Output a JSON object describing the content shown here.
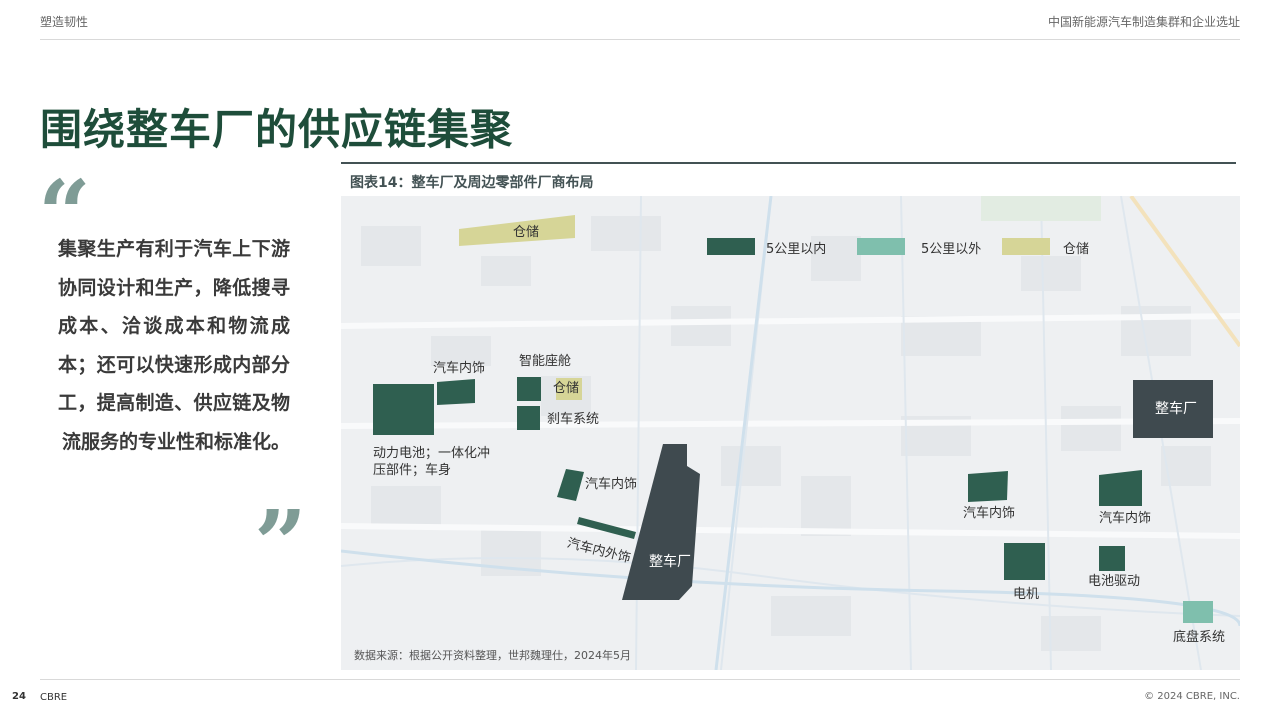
{
  "header": {
    "section": "塑造韧性",
    "report": "中国新能源汽车制造集群和企业选址"
  },
  "page_title": "围绕整车厂的供应链集聚",
  "quote": {
    "open_mark": "“",
    "close_mark": "”",
    "text": "集聚生产有利于汽车上下游协同设计和生产，降低搜寻成本、洽谈成本和物流成本；还可以快速形成内部分工，提高制造、供应链及物流服务的专业性和标准化。"
  },
  "figure": {
    "title": "图表14：整车厂及周边零部件厂商布局",
    "legend": [
      {
        "label": "5公里以内",
        "color": "#2f5f50"
      },
      {
        "label": "5公里以外",
        "color": "#7fbfad"
      },
      {
        "label": "仓储",
        "color": "#d6d597"
      }
    ],
    "colors": {
      "within_5km": "#2f5f50",
      "outside_5km": "#7fbfad",
      "warehouse": "#d6d597",
      "oem": "#3f4a4f"
    },
    "labels": {
      "warehouse_top": "仓储",
      "interior_1": "汽车内饰",
      "cockpit": "智能座舱",
      "warehouse_mid": "仓储",
      "brake": "刹车系统",
      "battery": "动力电池；一体化冲压部件；车身",
      "interior_2": "汽车内饰",
      "interior_exterior": "汽车内外饰",
      "oem_center": "整车厂",
      "oem_right": "整车厂",
      "interior_3": "汽车内饰",
      "interior_4": "汽车内饰",
      "motor": "电机",
      "battery_drive": "电池驱动",
      "chassis": "底盘系统"
    },
    "source": "数据来源：根据公开资料整理，世邦魏理仕，2024年5月"
  },
  "footer": {
    "page": "24",
    "brand": "CBRE",
    "copyright": "© 2024 CBRE, INC."
  }
}
